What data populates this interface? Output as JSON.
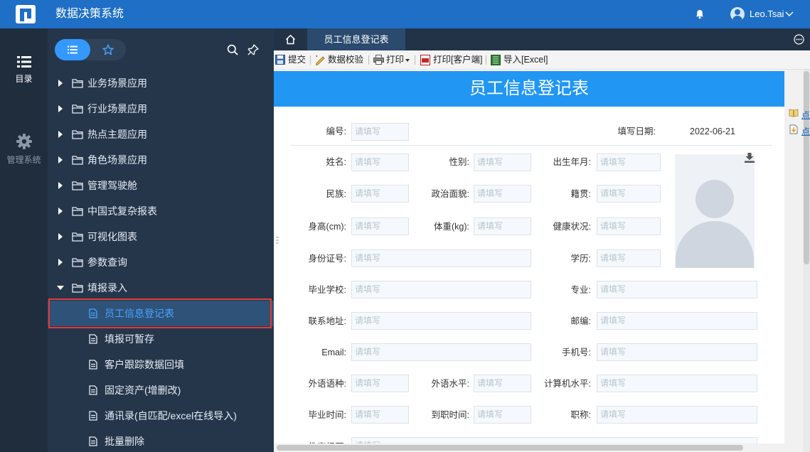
{
  "app": {
    "title": "数据决策系统"
  },
  "user": {
    "name": "Leo.Tsai"
  },
  "rail": {
    "items": [
      {
        "label": "目录",
        "icon": "list-icon"
      },
      {
        "label": "管理系统",
        "icon": "gear-icon"
      }
    ]
  },
  "tree": {
    "tabs": [
      {
        "icon": "list-icon"
      },
      {
        "icon": "star-icon"
      }
    ],
    "items": [
      {
        "label": "业务场景应用",
        "expanded": false
      },
      {
        "label": "行业场景应用",
        "expanded": false
      },
      {
        "label": "热点主题应用",
        "expanded": false
      },
      {
        "label": "角色场景应用",
        "expanded": false
      },
      {
        "label": "管理驾驶舱",
        "expanded": false
      },
      {
        "label": "中国式复杂报表",
        "expanded": false
      },
      {
        "label": "可视化图表",
        "expanded": false
      },
      {
        "label": "参数查询",
        "expanded": false
      },
      {
        "label": "填报录入",
        "expanded": true
      }
    ],
    "children": [
      {
        "label": "员工信息登记表",
        "active": true
      },
      {
        "label": "填报可暂存",
        "active": false
      },
      {
        "label": "客户跟踪数据回填",
        "active": false
      },
      {
        "label": "固定资产(增删改)",
        "active": false
      },
      {
        "label": "通讯录(自匹配/excel在线导入)",
        "active": false
      },
      {
        "label": "批量删除",
        "active": false
      }
    ]
  },
  "tabs": {
    "current": "员工信息登记表"
  },
  "toolbar": {
    "submit": "提交",
    "validate": "数据校验",
    "print": "打印",
    "print_client": "打印[客户端]",
    "import_excel": "导入[Excel]"
  },
  "report": {
    "title": "员工信息登记表",
    "placeholder": "请填写",
    "placeholder_long": "请填写...",
    "labels": {
      "number": "编号:",
      "fill_date": "填写日期:",
      "name": "姓名:",
      "gender": "性别:",
      "birth": "出生年月:",
      "ethnicity": "民族:",
      "political": "政治面貌:",
      "native_place": "籍贯:",
      "height": "身高(cm):",
      "weight": "体重(kg):",
      "health": "健康状况:",
      "id_number": "身份证号:",
      "education": "学历:",
      "school": "毕业学校:",
      "major": "专业:",
      "address": "联系地址:",
      "postcode": "邮编:",
      "email": "Email:",
      "mobile": "手机号:",
      "language": "外语语种:",
      "language_level": "外语水平:",
      "computer_level": "计算机水平:",
      "grad_time": "毕业时间:",
      "join_time": "到职时间:",
      "title": "职称:",
      "edu_history": "教育经历:"
    },
    "fill_date_value": "2022-06-21",
    "side_links": [
      "点",
      "点"
    ]
  },
  "colors": {
    "topbar": "#1e6fc5",
    "rail": "#1f2d3d",
    "tree": "#25364b",
    "accent": "#2196f3",
    "active_text": "#4aa3ff",
    "highlight_border": "#e53935"
  }
}
